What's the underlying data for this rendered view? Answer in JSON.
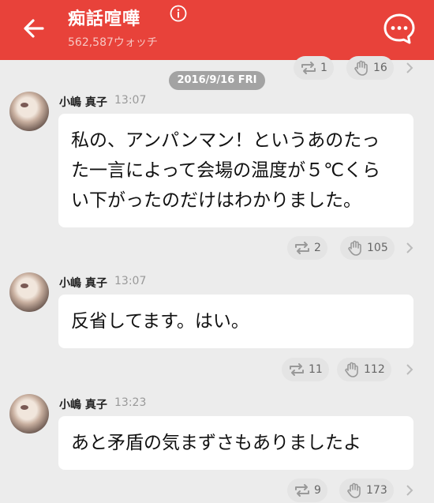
{
  "header": {
    "title": "痴話喧嘩",
    "watch_count": "562,587ウォッチ",
    "bg_color": "#e8423a"
  },
  "top_reactions": {
    "repost_count": "1",
    "clap_count": "16"
  },
  "date_label": "2016/9/16 FRI",
  "messages": [
    {
      "author": "小嶋 真子",
      "time": "13:07",
      "lines": [
        "私の、アンパンマン！というあのたっ",
        "た一言によって会場の温度が５℃くら",
        "い下がったのだけはわかりました。"
      ],
      "repost_count": "2",
      "clap_count": "105"
    },
    {
      "author": "小嶋 真子",
      "time": "13:07",
      "lines": [
        "反省してます。はい。"
      ],
      "repost_count": "11",
      "clap_count": "112"
    },
    {
      "author": "小嶋 真子",
      "time": "13:23",
      "lines": [
        "あと矛盾の気まずさもありましたよ"
      ],
      "repost_count": "9",
      "clap_count": "173"
    }
  ],
  "icons": {
    "back": "arrow-left-icon",
    "info": "info-icon",
    "menu": "chat-bubble-menu-icon",
    "repost": "repost-icon",
    "clap": "clap-hand-icon",
    "chevron": "chevron-right-icon"
  }
}
